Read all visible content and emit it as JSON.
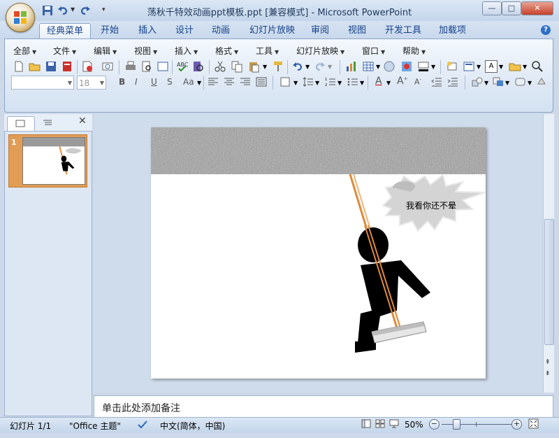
{
  "window": {
    "title": "荡秋千特效动画ppt模板.ppt [兼容模式] - Microsoft PowerPoint",
    "minimize": "—",
    "maximize": "□",
    "close": "✕"
  },
  "tabs": [
    "经典菜单",
    "开始",
    "插入",
    "设计",
    "动画",
    "幻灯片放映",
    "审阅",
    "视图",
    "开发工具",
    "加载项"
  ],
  "active_tab": "经典菜单",
  "menus": [
    "全部",
    "文件",
    "编辑",
    "视图",
    "插入",
    "格式",
    "工具",
    "幻灯片放映",
    "窗口",
    "帮助"
  ],
  "font_combo": {
    "font": "",
    "size": "18"
  },
  "slide_panel": {
    "thumbnail_number": "1"
  },
  "slide": {
    "speech_bubble_text": "我看你还不晕",
    "top_band_color": "#9a9a9a",
    "rope_color": "#e08a3a"
  },
  "notes_placeholder": "单击此处添加备注",
  "status": {
    "slide_count": "幻灯片 1/1",
    "theme": "\"Office 主题\"",
    "language": "中文(简体，中国)",
    "zoom": "50%"
  }
}
